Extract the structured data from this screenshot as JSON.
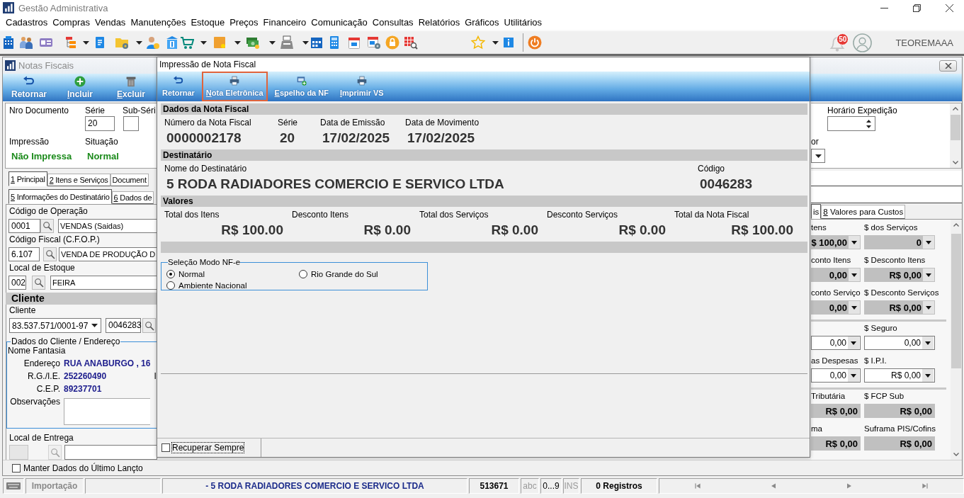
{
  "app": {
    "title": "Gestão Administrativa",
    "menu": [
      "Cadastros",
      "Compras",
      "Vendas",
      "Manutenções",
      "Estoque",
      "Preços",
      "Financeiro",
      "Comunicação",
      "Consultas",
      "Relatórios",
      "Gráficos",
      "Utilitários"
    ],
    "notification_count": "50",
    "user": "TEOREMAAA"
  },
  "notas_fiscais": {
    "title": "Notas Fiscais",
    "toolbar": [
      {
        "label": "Retornar",
        "mnemonic": false
      },
      {
        "label": "Incluir",
        "mnemonic": true
      },
      {
        "label": "Excluir",
        "mnemonic": true
      }
    ],
    "header": {
      "document_label": "Nro Documento",
      "series": {
        "label": "Série",
        "value": "20"
      },
      "subseries": {
        "label": "Sub-Séri"
      },
      "printing": {
        "label": "Impressão",
        "value": "Não Impressa"
      },
      "status": {
        "label": "Situação",
        "value": "Normal"
      },
      "dispatch_time": {
        "label": "Horário Expedição"
      },
      "cut_label": "or"
    },
    "tabs": [
      {
        "label": "1 Principal",
        "selected": true,
        "mnemonic": true
      },
      {
        "label": "2 Itens e Serviços",
        "selected": false,
        "mnemonic": true
      },
      {
        "label": "Document",
        "selected": false,
        "mnemonic": false
      }
    ],
    "subtabs": [
      {
        "label": "5 Informações do Destinatário",
        "selected": true,
        "mnemonic": true
      },
      {
        "label": "6 Dados de",
        "selected": false,
        "mnemonic": true
      }
    ],
    "lookups": [
      {
        "label": "Código de Operação",
        "code": "0001",
        "description": "VENDAS (Saidas)"
      },
      {
        "label": "Código Fiscal (C.F.O.P.)",
        "code": "6.107",
        "description": "VENDA DE PRODUÇÃO D"
      },
      {
        "label": "Local de Estoque",
        "code": "002",
        "description": "FEIRA"
      }
    ],
    "client": {
      "heading": "Cliente",
      "label": "Cliente",
      "document": "83.537.571/0001-97",
      "code": "0046283"
    },
    "address": {
      "legend": "Dados do Cliente / Endereço",
      "trade_name_label": "Nome Fantasia",
      "rows": [
        {
          "label": "Endereço",
          "value": "RUA ANABURGO , 16"
        },
        {
          "label": "R.G./I.E.",
          "value": "252260490",
          "side_label": "I"
        },
        {
          "label": "C.E.P.",
          "value": "89237701"
        }
      ],
      "notes_label": "Observações"
    },
    "delivery": {
      "label": "Local de Entrega",
      "disabled": true
    },
    "value_tabs": [
      {
        "label": "is",
        "selected": true,
        "mnemonic": false
      },
      {
        "label": "8 Valores para Custos",
        "selected": false,
        "mnemonic": true
      }
    ],
    "value_groups": [
      {
        "kind": "computed",
        "cells": [
          {
            "label": "tens",
            "value": "$ 100,00"
          },
          {
            "label": "conto Itens",
            "value": "0,00"
          },
          {
            "label": "conto Serviço",
            "value": "0,00"
          },
          {
            "label": "$ dos Serviços",
            "value": "0"
          },
          {
            "label": "$ Desconto Itens",
            "value": "R$ 0,00"
          },
          {
            "label": "$ Desconto Serviços",
            "value": "R$ 0,00"
          }
        ]
      },
      {
        "kind": "input",
        "cells": [
          {
            "value": "0,00"
          },
          {
            "label": "as Despesas",
            "value": "0,00"
          },
          {
            "label": "$ Seguro",
            "value": "0,00"
          },
          {
            "label": "$ I.P.I.",
            "value": "R$ 0,00"
          }
        ]
      },
      {
        "kind": "readonly",
        "cells": [
          {
            "label": "Tributária",
            "value": "R$ 0,00"
          },
          {
            "label": "ma",
            "value": "R$ 0,00"
          },
          {
            "label": "$ FCP Sub",
            "value": "R$ 0,00"
          },
          {
            "label": "Suframa PIS/Cofins",
            "value": "R$ 0,00"
          }
        ]
      }
    ],
    "keep_last": {
      "label": "Manter Dados do Último Lançto",
      "checked": false
    }
  },
  "print_dialog": {
    "title": "Impressão de Nota Fiscal",
    "toolbar": [
      {
        "label": "Retornar",
        "mnemonic": false,
        "selected": false
      },
      {
        "label": "Nota Eletrônica",
        "mnemonic": true,
        "selected": true
      },
      {
        "label": "Espelho da NF",
        "mnemonic": true,
        "selected": false
      },
      {
        "label": "Imprimir VS",
        "mnemonic": true,
        "selected": false
      }
    ],
    "invoice": {
      "heading": "Dados da Nota Fiscal",
      "fields": [
        {
          "label": "Número da Nota Fiscal",
          "value": "0000002178"
        },
        {
          "label": "Série",
          "value": "20"
        },
        {
          "label": "Data de Emissão",
          "value": "17/02/2025"
        },
        {
          "label": "Data de Movimento",
          "value": "17/02/2025"
        }
      ]
    },
    "recipient": {
      "heading": "Destinatário",
      "fields": [
        {
          "label": "Nome do Destinatário",
          "value": "5 RODA RADIADORES COMERCIO E SERVICO LTDA"
        },
        {
          "label": "Código",
          "value": "0046283"
        }
      ]
    },
    "totals": {
      "heading": "Valores",
      "fields": [
        {
          "label": "Total dos Itens",
          "value": "R$ 100.00"
        },
        {
          "label": "Desconto Itens",
          "value": "R$ 0.00"
        },
        {
          "label": "Total dos Serviços",
          "value": "R$ 0.00"
        },
        {
          "label": "Desconto Serviços",
          "value": "R$ 0.00"
        },
        {
          "label": "Total da Nota Fiscal",
          "value": "R$ 100.00"
        }
      ]
    },
    "nfe_mode": {
      "legend": "Seleção Modo NF-e",
      "options": [
        {
          "label": "Normal",
          "selected": true
        },
        {
          "label": "Rio Grande do Sul",
          "selected": false
        },
        {
          "label": "Ambiente Nacional",
          "selected": false
        }
      ]
    },
    "recover_always": {
      "label": "Recuperar Sempre",
      "checked": false
    }
  },
  "status_bar": {
    "mode": {
      "label": "Importação",
      "disabled": true
    },
    "customer": "- 5 RODA RADIADORES COMERCIO E SERVICO LTDA",
    "number": "513671",
    "indicators": [
      {
        "label": "abc",
        "on": false
      },
      {
        "label": "0...9",
        "on": true
      },
      {
        "label": "INS",
        "on": false
      }
    ],
    "records": "0 Registros"
  }
}
